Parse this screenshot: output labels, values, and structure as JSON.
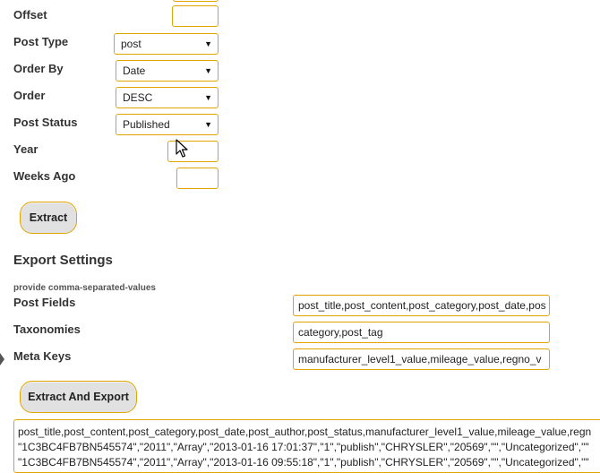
{
  "filters": {
    "offset": {
      "label": "Offset",
      "value": ""
    },
    "post_type": {
      "label": "Post Type",
      "value": "post"
    },
    "order_by": {
      "label": "Order By",
      "value": "Date"
    },
    "order": {
      "label": "Order",
      "value": "DESC"
    },
    "post_status": {
      "label": "Post Status",
      "value": "Published"
    },
    "year": {
      "label": "Year",
      "value": ""
    },
    "weeks_ago": {
      "label": "Weeks Ago",
      "value": ""
    }
  },
  "extract_button": "Extract",
  "export": {
    "heading": "Export Settings",
    "hint": "provide comma-separated-values",
    "post_fields": {
      "label": "Post Fields",
      "value": "post_title,post_content,post_category,post_date,pos"
    },
    "taxonomies": {
      "label": "Taxonomies",
      "value": "category,post_tag"
    },
    "meta_keys": {
      "label": "Meta Keys",
      "value": "manufacturer_level1_value,mileage_value,regno_v"
    },
    "button": "Extract And Export"
  },
  "output": {
    "line1": "post_title,post_content,post_category,post_date,post_author,post_status,manufacturer_level1_value,mileage_value,regn",
    "line2": "\"1C3BC4FB7BN545574\",\"2011\",\"Array\",\"2013-01-16 17:01:37\",\"1\",\"publish\",\"CHRYSLER\",\"20569\",\"\",\"Uncategorized\",\"\"",
    "line3": "\"1C3BC4FB7BN545574\",\"2011\",\"Array\",\"2013-01-16 09:55:18\",\"1\",\"publish\",\"CHRYSLER\",\"20569\",\"\",\"Uncategorized\",\"\""
  },
  "icons": {
    "caret": "triangle-down-icon",
    "pointer": "mouse-cursor-icon"
  },
  "colors": {
    "accent_border": "#e2a400",
    "button_bg": "#e1e1e1"
  }
}
